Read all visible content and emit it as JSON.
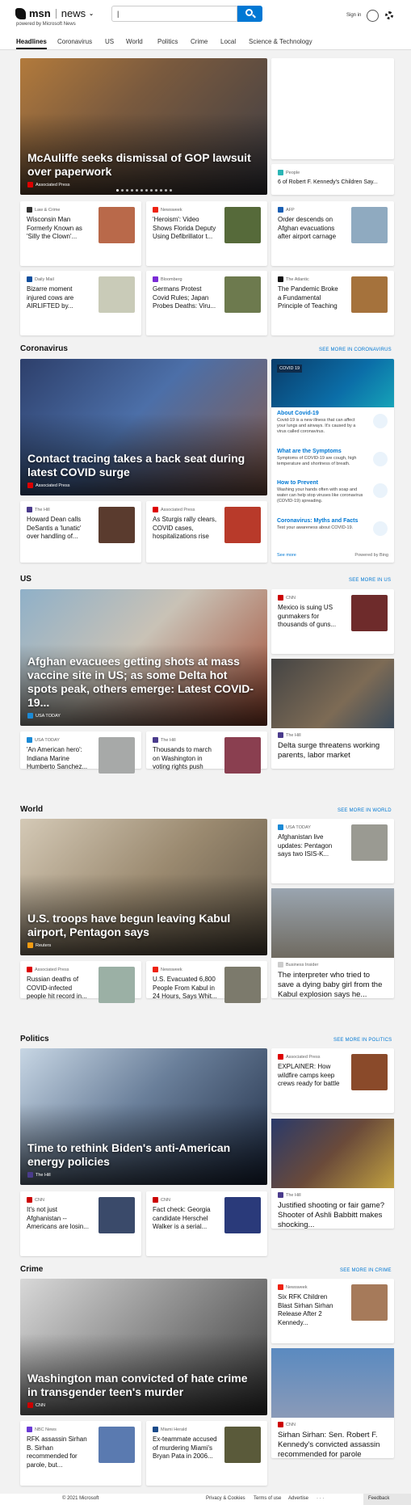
{
  "header": {
    "brand": "msn",
    "news": "news",
    "powered": "powered by Microsoft News",
    "search_value": "|",
    "signin": "Sign in"
  },
  "nav": [
    "Headlines",
    "Coronavirus",
    "US",
    "World",
    "Politics",
    "Crime",
    "Local",
    "Science & Technology"
  ],
  "top": {
    "hero": {
      "title": "McAuliffe seeks dismissal of GOP lawsuit over paperwork",
      "source": "Associated Press"
    },
    "side_small": {
      "source": "People",
      "title": "6 of Robert F. Kennedy's Children Say..."
    },
    "cards": [
      {
        "source": "Law & Crime",
        "title": "Wisconsin Man Formerly Known as 'Silly the Clown'..."
      },
      {
        "source": "Newsweek",
        "title": "'Heroism': Video Shows Florida Deputy Using Defibrillator t..."
      },
      {
        "source": "AFP",
        "title": "Order descends on Afghan evacuations after airport carnage"
      },
      {
        "source": "Daily Mail",
        "title": "Bizarre moment injured cows are AIRLIFTED by..."
      },
      {
        "source": "Bloomberg",
        "title": "Germans Protest Covid Rules; Japan Probes Deaths: Viru..."
      },
      {
        "source": "The Atlantic",
        "title": "The Pandemic Broke a Fundamental Principle of Teaching"
      }
    ]
  },
  "coronavirus": {
    "title": "Coronavirus",
    "see_more": "SEE MORE IN CORONAVIRUS",
    "hero": {
      "title": "Contact tracing takes a back seat during latest COVID surge",
      "source": "Associated Press"
    },
    "cards": [
      {
        "source": "The Hill",
        "title": "Howard Dean calls DeSantis a 'lunatic' over handling of..."
      },
      {
        "source": "Associated Press",
        "title": "As Sturgis rally clears, COVID cases, hospitalizations rise"
      }
    ],
    "panel": {
      "badge": "COVID 19",
      "items": [
        {
          "title": "About Covid-19",
          "desc": "Covid-19 is a new illness that can affect your lungs and airways. It's caused by a virus called coronavirus."
        },
        {
          "title": "What are the Symptoms",
          "desc": "Symptoms of COVID-19 are cough, high temperature and shortness of breath."
        },
        {
          "title": "How to Prevent",
          "desc": "Washing your hands often with soap and water can help stop viruses like coronavirus (COVID-19) spreading."
        },
        {
          "title": "Coronavirus: Myths and Facts",
          "desc": "Test your awareness about COVID-19."
        }
      ],
      "see_more": "See more",
      "powered": "Powered by Bing"
    }
  },
  "us": {
    "title": "US",
    "see_more": "SEE MORE IN US",
    "hero": {
      "title": "Afghan evacuees getting shots at mass vaccine site in US; as some Delta hot spots peak, others emerge: Latest COVID-19...",
      "source": "USA TODAY"
    },
    "side_small": {
      "source": "CNN",
      "title": "Mexico is suing US gunmakers for thousands of guns..."
    },
    "side_big": {
      "source": "The Hill",
      "title": "Delta surge threatens working parents, labor market"
    },
    "cards": [
      {
        "source": "USA TODAY",
        "title": "'An American hero': Indiana Marine Humberto Sanchez..."
      },
      {
        "source": "The Hill",
        "title": "Thousands to march on Washington in voting rights push"
      }
    ]
  },
  "world": {
    "title": "World",
    "see_more": "SEE MORE IN WORLD",
    "hero": {
      "title": "U.S. troops have begun leaving Kabul airport, Pentagon says",
      "source": "Reuters"
    },
    "side_small": {
      "source": "USA TODAY",
      "title": "Afghanistan live updates: Pentagon says two ISIS-K..."
    },
    "side_big": {
      "source": "Business Insider",
      "title": "The interpreter who tried to save a dying baby girl from the Kabul explosion says he..."
    },
    "cards": [
      {
        "source": "Associated Press",
        "title": "Russian deaths of COVID-infected people hit record in..."
      },
      {
        "source": "Newsweek",
        "title": "U.S. Evacuated 6,800 People From Kabul in 24 Hours, Says Whit..."
      }
    ]
  },
  "politics": {
    "title": "Politics",
    "see_more": "SEE MORE IN POLITICS",
    "hero": {
      "title": "Time to rethink Biden's anti-American energy policies",
      "source": "The Hill"
    },
    "side_small": {
      "source": "Associated Press",
      "title": "EXPLAINER: How wildfire camps keep crews ready for battle"
    },
    "side_big": {
      "source": "The Hill",
      "title": "Justified shooting or fair game? Shooter of Ashli Babbitt makes shocking..."
    },
    "cards": [
      {
        "source": "CNN",
        "title": "It's not just Afghanistan -- Americans are losin..."
      },
      {
        "source": "CNN",
        "title": "Fact check: Georgia candidate Herschel Walker is a serial..."
      }
    ]
  },
  "crime": {
    "title": "Crime",
    "see_more": "SEE MORE IN CRIME",
    "hero": {
      "title": "Washington man convicted of hate crime in transgender teen's murder",
      "source": "CNN"
    },
    "side_small": {
      "source": "Newsweek",
      "title": "Six RFK Children Blast Sirhan Sirhan Release After 2 Kennedy..."
    },
    "side_big": {
      "source": "CNN",
      "title": "Sirhan Sirhan: Sen. Robert F. Kennedy's convicted assassin recommended for parole"
    },
    "cards": [
      {
        "source": "NBC News",
        "title": "RFK assassin Sirhan B. Sirhan recommended for parole, but..."
      },
      {
        "source": "Miami Herald",
        "title": "Ex-teammate accused of murdering Miami's Bryan Pata in 2006..."
      }
    ]
  },
  "footer": {
    "copyright": "© 2021 Microsoft",
    "privacy": "Privacy & Cookies",
    "terms": "Terms of use",
    "advertise": "Advertise",
    "more": "· · ·",
    "feedback": "Feedback"
  }
}
